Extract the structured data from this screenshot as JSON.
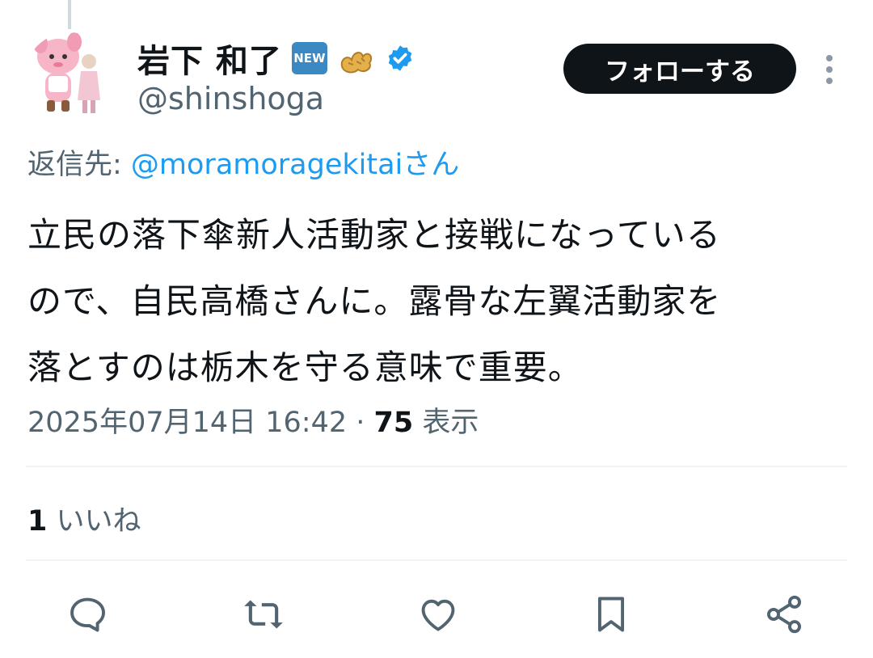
{
  "tweet": {
    "author": {
      "display_name": "岩下 和了",
      "new_emoji": "NEW",
      "handle": "@shinshoga",
      "verified": true
    },
    "follow_label": "フォローする",
    "reply_to": {
      "prefix": "返信先: ",
      "mention": "@moramoragekitai",
      "suffix": "さん"
    },
    "text_lines": [
      "立民の落下傘新人活動家と接戦になっている",
      "ので、自民高橋さんに。露骨な左翼活動家を",
      "落とすのは栃木を守る意味で重要。"
    ],
    "timestamp": "2025年07月14日 16:42",
    "separator": " · ",
    "views_count": "75",
    "views_label": " 表示",
    "likes_count": "1",
    "likes_label": " いいね"
  },
  "icons": {
    "more": "more-vertical-icon",
    "reply": "reply-icon",
    "retweet": "retweet-icon",
    "like": "heart-icon",
    "bookmark": "bookmark-icon",
    "share": "share-icon"
  },
  "colors": {
    "accent": "#1d9bf0",
    "secondary_text": "#536471",
    "button_bg": "#0f1419",
    "divider": "#eff3f4"
  }
}
